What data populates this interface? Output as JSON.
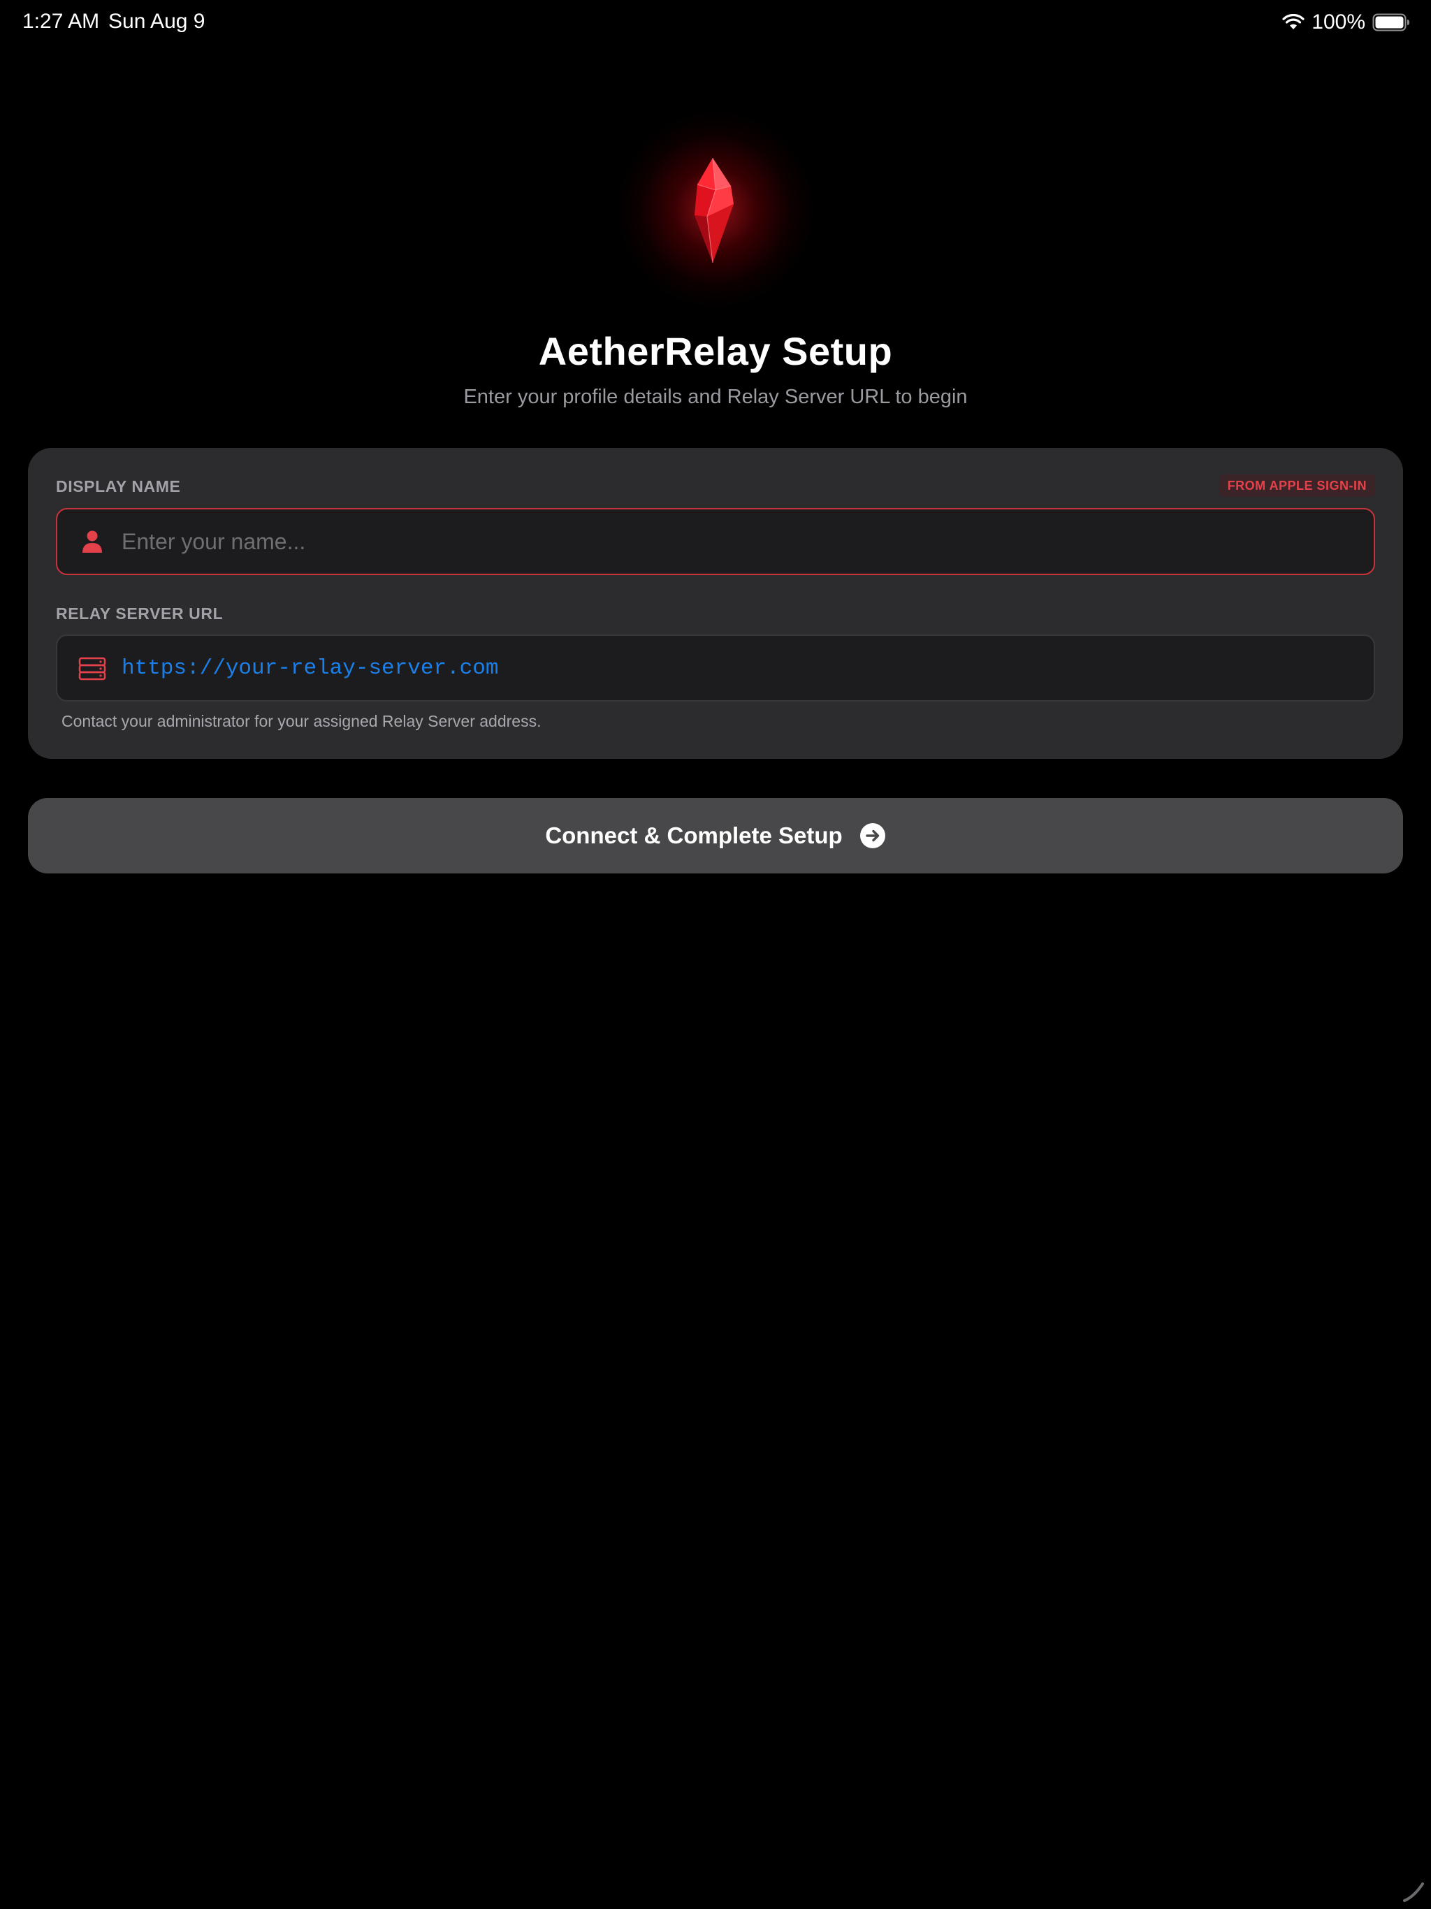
{
  "status_bar": {
    "time": "1:27 AM",
    "date": "Sun Aug 9",
    "battery_percent": "100%",
    "icons": [
      "wifi-icon",
      "battery-icon"
    ]
  },
  "header": {
    "logo_icon": "red-crystal-gem-icon",
    "title": "AetherRelay Setup",
    "subtitle": "Enter your profile details and Relay Server URL to begin"
  },
  "form": {
    "display_name": {
      "label": "DISPLAY NAME",
      "badge": "FROM APPLE SIGN-IN",
      "icon": "person-icon",
      "placeholder": "Enter your name...",
      "value": ""
    },
    "relay_url": {
      "label": "RELAY SERVER URL",
      "icon": "server-icon",
      "placeholder": "https://your-relay-server.com",
      "value": "",
      "help": "Contact your administrator for your assigned Relay Server address."
    }
  },
  "actions": {
    "connect_label": "Connect & Complete Setup",
    "connect_icon": "arrow-right-circle-icon"
  },
  "colors": {
    "accent": "#e5414b",
    "link_blue": "#1a8cff",
    "card_bg": "#2c2c2e",
    "button_bg": "#48484a"
  }
}
